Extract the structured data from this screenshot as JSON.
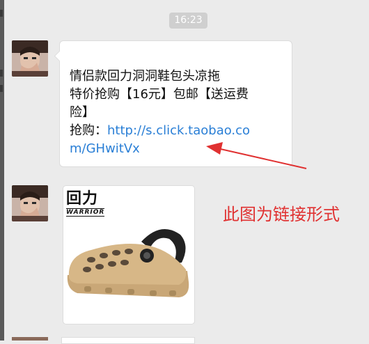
{
  "chat": {
    "timestamp": "16:23",
    "message": {
      "line1": "情侣款回力洞洞鞋包头凉拖",
      "line2": "特价抢购【16元】包邮【送运费",
      "line3": "险】",
      "link_prefix": "抢购：",
      "link_part1": "http://s.click.taobao.co",
      "link_part2": "m/GHwitVx"
    },
    "image_message": {
      "brand": "回力",
      "brand_sub": "WARRIOR"
    }
  },
  "annotation": {
    "text": "此图为链接形式",
    "color": "#e03131"
  },
  "colors": {
    "background": "#ebebeb",
    "link": "#2a7fd6",
    "bubble": "#ffffff"
  }
}
